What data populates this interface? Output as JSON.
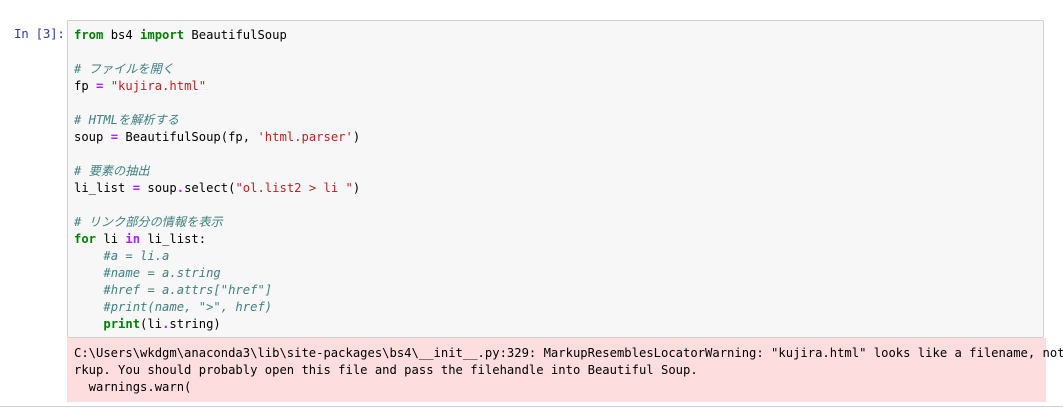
{
  "cell": {
    "prompt": "In [3]:",
    "code_lines": [
      [
        {
          "t": "from",
          "c": "kw"
        },
        {
          "t": " bs4 ",
          "c": "name"
        },
        {
          "t": "import",
          "c": "kw"
        },
        {
          "t": " BeautifulSoup",
          "c": "name"
        }
      ],
      [],
      [
        {
          "t": "# ファイルを開く",
          "c": "comment"
        }
      ],
      [
        {
          "t": "fp ",
          "c": "name"
        },
        {
          "t": "=",
          "c": "op"
        },
        {
          "t": " ",
          "c": "name"
        },
        {
          "t": "\"kujira.html\"",
          "c": "str"
        }
      ],
      [],
      [
        {
          "t": "# HTMLを解析する",
          "c": "comment"
        }
      ],
      [
        {
          "t": "soup ",
          "c": "name"
        },
        {
          "t": "=",
          "c": "op"
        },
        {
          "t": " BeautifulSoup(fp, ",
          "c": "name"
        },
        {
          "t": "'html.parser'",
          "c": "str"
        },
        {
          "t": ")",
          "c": "name"
        }
      ],
      [],
      [
        {
          "t": "# 要素の抽出",
          "c": "comment"
        }
      ],
      [
        {
          "t": "li_list ",
          "c": "name"
        },
        {
          "t": "=",
          "c": "op"
        },
        {
          "t": " soup",
          "c": "name"
        },
        {
          "t": ".",
          "c": "op"
        },
        {
          "t": "select(",
          "c": "name"
        },
        {
          "t": "\"ol.list2 > li \"",
          "c": "str"
        },
        {
          "t": ")",
          "c": "name"
        }
      ],
      [],
      [
        {
          "t": "# リンク部分の情報を表示",
          "c": "comment"
        }
      ],
      [
        {
          "t": "for",
          "c": "kw"
        },
        {
          "t": " li ",
          "c": "name"
        },
        {
          "t": "in",
          "c": "op"
        },
        {
          "t": " li_list:",
          "c": "name"
        }
      ],
      [
        {
          "t": "    ",
          "c": "name"
        },
        {
          "t": "#a = li.a",
          "c": "comment"
        }
      ],
      [
        {
          "t": "    ",
          "c": "name"
        },
        {
          "t": "#name = a.string",
          "c": "comment"
        }
      ],
      [
        {
          "t": "    ",
          "c": "name"
        },
        {
          "t": "#href = a.attrs[\"href\"]",
          "c": "comment"
        }
      ],
      [
        {
          "t": "    ",
          "c": "name"
        },
        {
          "t": "#print(name, \">\", href)",
          "c": "comment"
        }
      ],
      [
        {
          "t": "    ",
          "c": "name"
        },
        {
          "t": "print",
          "c": "kw"
        },
        {
          "t": "(li",
          "c": "name"
        },
        {
          "t": ".",
          "c": "op"
        },
        {
          "t": "string)",
          "c": "name"
        }
      ]
    ],
    "output_lines": [
      "C:\\Users\\wkdgm\\anaconda3\\lib\\site-packages\\bs4\\__init__.py:329: MarkupResemblesLocatorWarning: \"kujira.html\" looks like a filename, not ma",
      "rkup. You should probably open this file and pass the filehandle into Beautiful Soup.",
      "  warnings.warn("
    ]
  },
  "colors": {
    "prompt": "#303f9f",
    "input_bg": "#f7f7f7",
    "input_border": "#cfcfcf",
    "stderr_bg": "#fddddd",
    "keyword": "#008000",
    "operator": "#aa22ff",
    "string": "#ba2121",
    "comment": "#408080"
  }
}
